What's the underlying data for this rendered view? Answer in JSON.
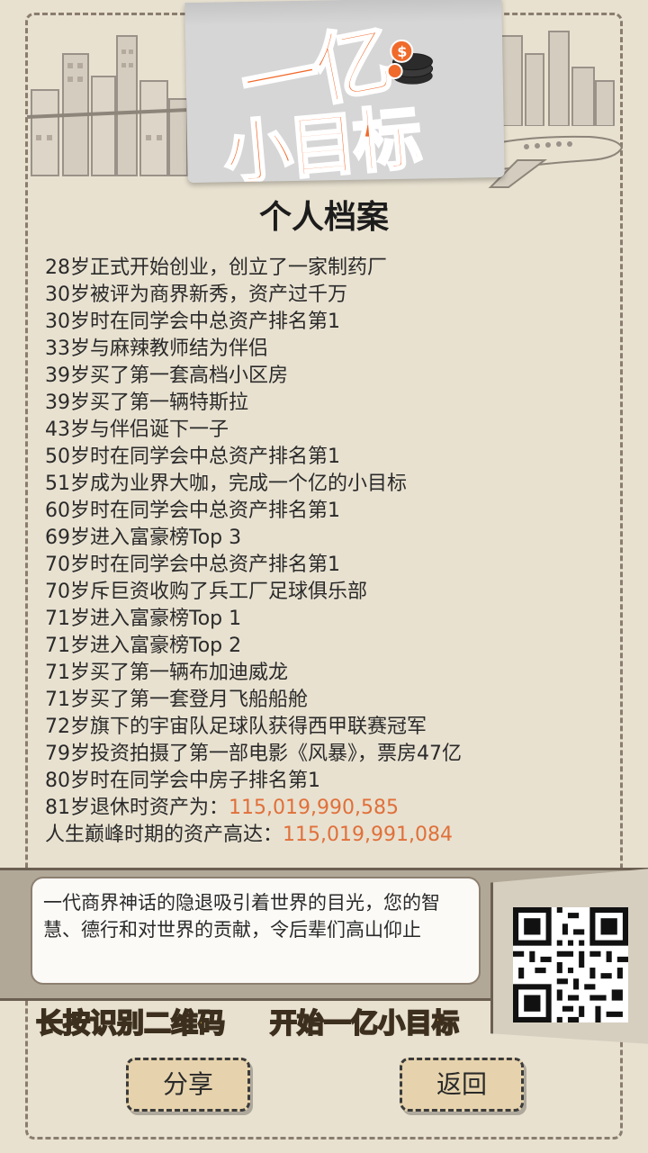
{
  "logo": {
    "line1": "一亿",
    "line2": "小目标"
  },
  "title": "个人档案",
  "records": [
    {
      "text": "28岁正式开始创业，创立了一家制药厂"
    },
    {
      "text": "30岁被评为商界新秀，资产过千万"
    },
    {
      "text": "30岁时在同学会中总资产排名第1"
    },
    {
      "text": "33岁与麻辣教师结为伴侣"
    },
    {
      "text": "39岁买了第一套高档小区房"
    },
    {
      "text": "39岁买了第一辆特斯拉"
    },
    {
      "text": "43岁与伴侣诞下一子"
    },
    {
      "text": "50岁时在同学会中总资产排名第1"
    },
    {
      "text": "51岁成为业界大咖，完成一个亿的小目标"
    },
    {
      "text": "60岁时在同学会中总资产排名第1"
    },
    {
      "text": "69岁进入富豪榜Top 3"
    },
    {
      "text": "70岁时在同学会中总资产排名第1"
    },
    {
      "text": "70岁斥巨资收购了兵工厂足球俱乐部"
    },
    {
      "text": "71岁进入富豪榜Top 1"
    },
    {
      "text": "71岁进入富豪榜Top 2"
    },
    {
      "text": "71岁买了第一辆布加迪威龙"
    },
    {
      "text": "71岁买了第一套登月飞船船舱"
    },
    {
      "text": "72岁旗下的宇宙队足球队获得西甲联赛冠军"
    },
    {
      "text": "79岁投资拍摄了第一部电影《风暴》，票房47亿"
    },
    {
      "text": "80岁时在同学会中房子排名第1"
    }
  ],
  "retire": {
    "label": "81岁退休时资产为：",
    "value": "115,019,990,585"
  },
  "peak": {
    "label": "人生巅峰时期的资产高达：",
    "value": "115,019,991,084"
  },
  "speech": "一代商界神话的隐退吸引着世界的目光，您的智慧、德行和对世界的贡献，令后辈们高山仰止",
  "bottom": {
    "left_text": "长按识别二维码",
    "right_text": "开始一亿小目标"
  },
  "buttons": {
    "share": "分享",
    "back": "返回"
  },
  "colors": {
    "accent": "#f06a2b",
    "value": "#e0703a",
    "yellow": "#f2c23a"
  }
}
